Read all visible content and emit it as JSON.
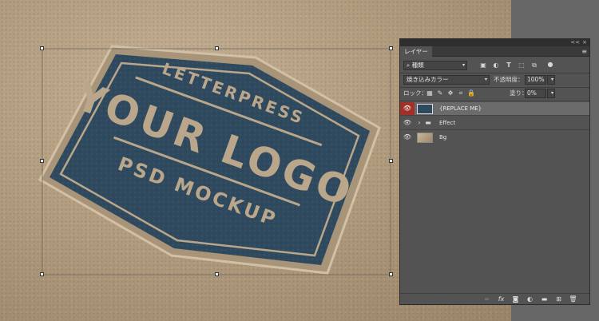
{
  "canvas": {
    "badge": {
      "top_text": "LETTERPRESS",
      "main_text": "YOUR LOGO",
      "bottom_text": "PSD MOCKUP",
      "fill_color": "#2f4a5e",
      "text_color": "#b9a68b"
    }
  },
  "panel": {
    "tab_label": "レイヤー",
    "collapse_icon": "<<",
    "close_icon": "×",
    "filter": {
      "value": "種類",
      "icons": [
        "image-filter-icon",
        "adjustment-filter-icon",
        "text-filter-icon",
        "shape-filter-icon",
        "smart-object-filter-icon",
        "filter-toggle-icon"
      ]
    },
    "blend_mode": "焼き込みカラー",
    "opacity_label": "不透明度：",
    "opacity_value": "100%",
    "lock_label": "ロック：",
    "fill_label": "塗り：",
    "fill_value": "0%",
    "layers": [
      {
        "name": "{REPLACE ME}",
        "type": "smart-object",
        "selected": true
      },
      {
        "name": "Effect",
        "type": "group",
        "selected": false
      },
      {
        "name": "Bg",
        "type": "image",
        "selected": false
      }
    ],
    "bottom_icons": [
      "link-icon",
      "fx-icon",
      "mask-icon",
      "adjustment-icon",
      "folder-icon",
      "new-layer-icon",
      "trash-icon"
    ],
    "fx_label": "fx"
  }
}
